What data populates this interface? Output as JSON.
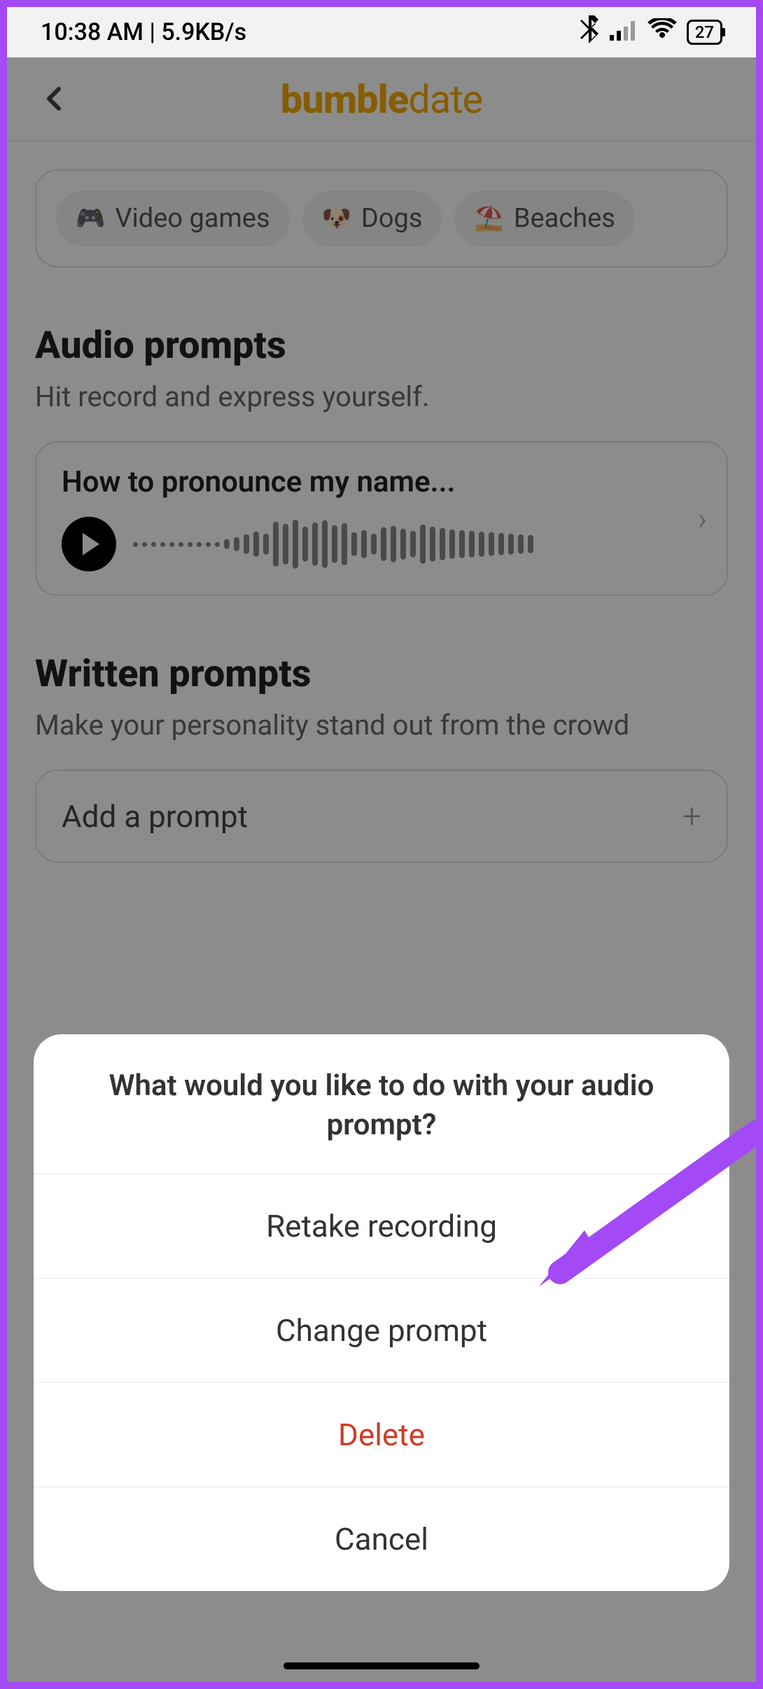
{
  "status": {
    "time_label": "10:38 AM | 5.9KB/s",
    "battery": "27"
  },
  "header": {
    "brand_a": "bumble",
    "brand_b": "date"
  },
  "interests": {
    "items": [
      {
        "icon": "🎮",
        "label": "Video games"
      },
      {
        "icon": "🐶",
        "label": "Dogs"
      },
      {
        "icon": "⛱️",
        "label": "Beaches"
      }
    ]
  },
  "audio_section": {
    "title": "Audio prompts",
    "subtitle": "Hit record and express yourself.",
    "prompt_label": "How to pronounce my name..."
  },
  "written_section": {
    "title": "Written prompts",
    "subtitle": "Make your personality stand out from the crowd",
    "add_label": "Add a prompt"
  },
  "sheet": {
    "title": "What would you like to do with your audio prompt?",
    "retake": "Retake recording",
    "change": "Change prompt",
    "delete": "Delete",
    "cancel": "Cancel"
  }
}
